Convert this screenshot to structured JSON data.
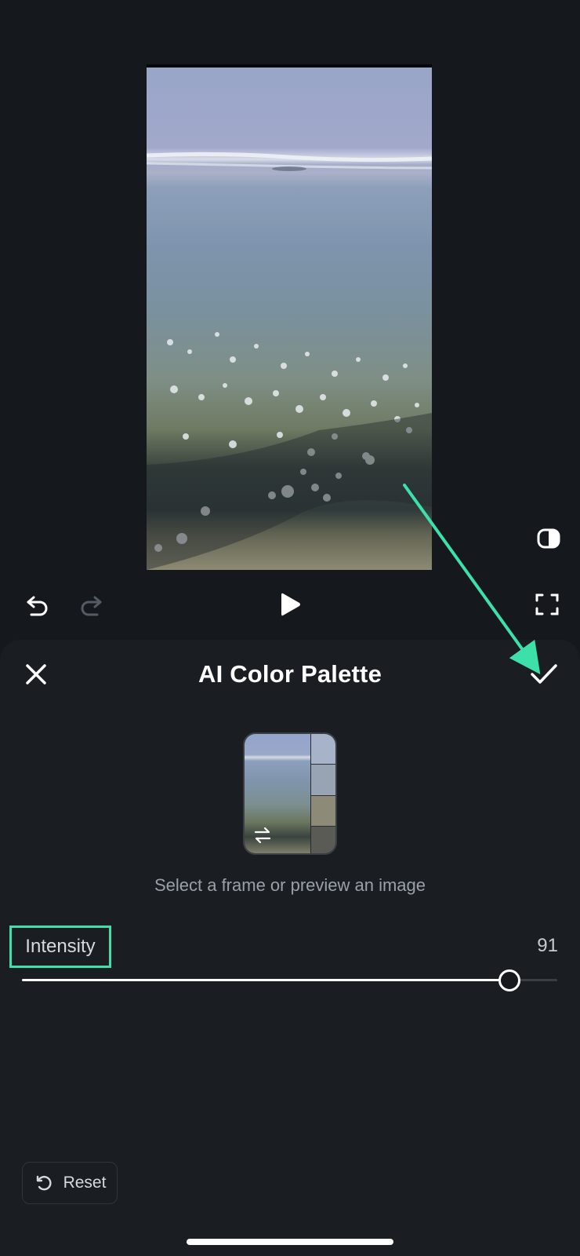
{
  "editor": {
    "controls": {
      "undo_icon": "undo-icon",
      "redo_icon": "redo-icon",
      "play_icon": "play-icon",
      "fullscreen_icon": "fullscreen-icon",
      "compare_icon": "compare-icon"
    }
  },
  "panel": {
    "title": "AI Color Palette",
    "close_icon": "close-icon",
    "confirm_icon": "check-icon",
    "thumbnail": {
      "swap_icon": "swap-icon",
      "swatches": [
        "#a7b3c9",
        "#98a3b4",
        "#8e8a78",
        "#5b5b55"
      ]
    },
    "hint": "Select a frame or preview an image",
    "intensity": {
      "label": "Intensity",
      "value": "91",
      "fraction": 0.91
    },
    "reset_label": "Reset",
    "reset_icon": "reset-icon"
  },
  "annotation": {
    "highlight_color": "#3de0a8"
  }
}
